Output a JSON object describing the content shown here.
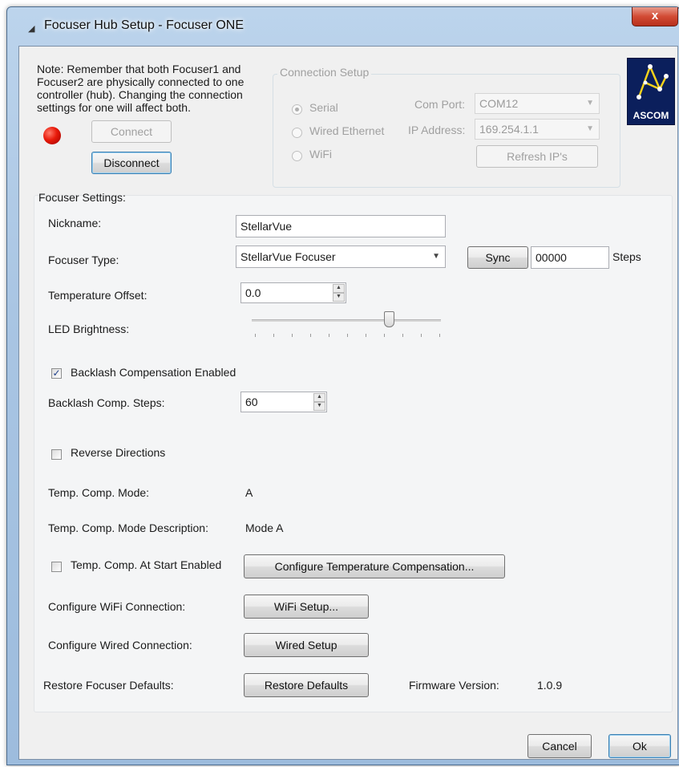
{
  "window": {
    "title": "Focuser Hub Setup - Focuser ONE",
    "close_label": "x"
  },
  "note": {
    "text": "Note: Remember that both Focuser1 and Focuser2 are physically connected to one controller (hub). Changing the connection settings for one will affect both."
  },
  "connection": {
    "status_color": "#e81a0a",
    "connect_label": "Connect",
    "disconnect_label": "Disconnect",
    "group_title": "Connection Setup",
    "radio_serial": "Serial",
    "radio_wired": "Wired Ethernet",
    "radio_wifi": "WiFi",
    "selected": "Serial",
    "com_port_label": "Com Port:",
    "com_port_value": "COM12",
    "ip_label": "IP Address:",
    "ip_value": "169.254.1.1",
    "refresh_label": "Refresh IP's"
  },
  "logo": {
    "text": "ASCOM",
    "icon": "ascom-constellation-icon"
  },
  "settings": {
    "group_title": "Focuser Settings:",
    "nickname_label": "Nickname:",
    "nickname_value": "StellarVue",
    "type_label": "Focuser Type:",
    "type_value": "StellarVue Focuser",
    "sync_label": "Sync",
    "steps_value": "00000",
    "steps_unit": "Steps",
    "temp_offset_label": "Temperature Offset:",
    "temp_offset_value": "0.0",
    "led_label": "LED Brightness:",
    "led_level_fraction": 0.75,
    "backlash_enabled_label": "Backlash Compensation Enabled",
    "backlash_enabled": true,
    "backlash_steps_label": "Backlash Comp. Steps:",
    "backlash_steps_value": "60",
    "reverse_label": "Reverse Directions",
    "reverse_checked": false,
    "temp_mode_label": "Temp. Comp. Mode:",
    "temp_mode_value": "A",
    "temp_mode_desc_label": "Temp. Comp. Mode Description:",
    "temp_mode_desc_value": "Mode A",
    "temp_start_label": "Temp. Comp. At Start Enabled",
    "temp_start_checked": false,
    "configure_temp_label": "Configure Temperature Compensation...",
    "wifi_conn_label": "Configure WiFi Connection:",
    "wifi_setup_label": "WiFi Setup...",
    "wired_conn_label": "Configure Wired Connection:",
    "wired_setup_label": "Wired Setup",
    "restore_label": "Restore Focuser Defaults:",
    "restore_button_label": "Restore Defaults",
    "firmware_label": "Firmware Version:",
    "firmware_value": "1.0.9"
  },
  "footer": {
    "cancel_label": "Cancel",
    "ok_label": "Ok"
  }
}
